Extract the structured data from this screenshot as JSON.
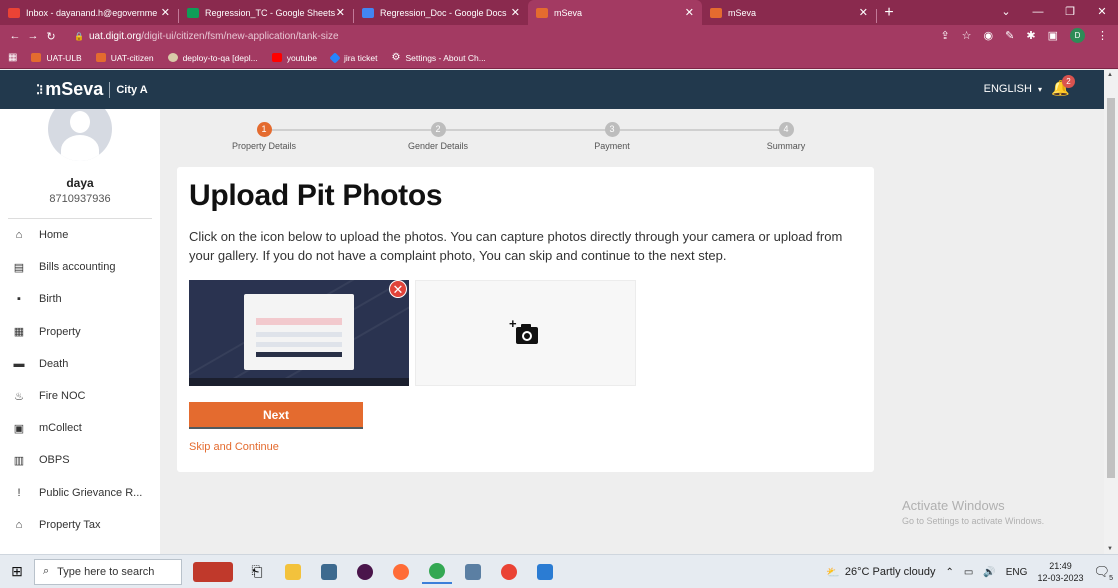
{
  "browser": {
    "tabs": [
      {
        "title": "Inbox - dayanand.h@egovernme",
        "icon_color": "#ea4335",
        "active": false
      },
      {
        "title": "Regression_TC - Google Sheets",
        "icon_color": "#0f9d58",
        "active": false
      },
      {
        "title": "Regression_Doc - Google Docs",
        "icon_color": "#4285f4",
        "active": false
      },
      {
        "title": "mSeva",
        "icon_color": "#e46b2f",
        "active": true
      },
      {
        "title": "mSeva",
        "icon_color": "#e46b2f",
        "active": false
      }
    ],
    "url_host": "uat.digit.org",
    "url_path": "/digit-ui/citizen/fsm/new-application/tank-size",
    "profile_initial": "D",
    "bookmarks": [
      {
        "label": "UAT-ULB",
        "icon_color": "#e46b2f"
      },
      {
        "label": "UAT-citizen",
        "icon_color": "#e46b2f"
      },
      {
        "label": "deploy-to-qa [depl...",
        "icon_color": "#d9c9a8"
      },
      {
        "label": "youtube",
        "icon_color": "#ff0000"
      },
      {
        "label": "jira ticket",
        "icon_color": "#2684ff"
      },
      {
        "label": "Settings - About Ch...",
        "icon_color": "#ffffff"
      }
    ]
  },
  "header": {
    "brand": "mSeva",
    "city": "City A",
    "language": "ENGLISH",
    "notification_count": "2"
  },
  "sidebar": {
    "user_name": "daya",
    "user_phone": "8710937936",
    "items": [
      {
        "label": "Home",
        "icon": "home-icon",
        "glyph": "⌂"
      },
      {
        "label": "Bills accounting",
        "icon": "bill-icon",
        "glyph": "▤"
      },
      {
        "label": "Birth",
        "icon": "birth-icon",
        "glyph": "▪"
      },
      {
        "label": "Property",
        "icon": "property-icon",
        "glyph": "▦"
      },
      {
        "label": "Death",
        "icon": "death-icon",
        "glyph": "▬"
      },
      {
        "label": "Fire NOC",
        "icon": "fire-icon",
        "glyph": "♨"
      },
      {
        "label": "mCollect",
        "icon": "collect-icon",
        "glyph": "▣"
      },
      {
        "label": "OBPS",
        "icon": "obps-icon",
        "glyph": "▥"
      },
      {
        "label": "Public Grievance R...",
        "icon": "grievance-icon",
        "glyph": "!"
      },
      {
        "label": "Property Tax",
        "icon": "property-tax-icon",
        "glyph": "⌂"
      }
    ]
  },
  "stepper": {
    "steps": [
      {
        "number": "1",
        "label": "Property Details",
        "active": true
      },
      {
        "number": "2",
        "label": "Gender Details",
        "active": false
      },
      {
        "number": "3",
        "label": "Payment",
        "active": false
      },
      {
        "number": "4",
        "label": "Summary",
        "active": false
      }
    ]
  },
  "main": {
    "title": "Upload Pit Photos",
    "description": "Click on the icon below to upload the photos. You can capture photos directly through your camera or upload from your gallery. If you do not have a complaint photo, You can skip and continue to the next step.",
    "next_label": "Next",
    "skip_label": "Skip and Continue"
  },
  "watermark": {
    "line1": "Activate Windows",
    "line2": "Go to Settings to activate Windows."
  },
  "taskbar": {
    "search_placeholder": "Type here to search",
    "weather": "26°C  Partly cloudy",
    "language": "ENG",
    "time": "21:49",
    "date": "12-03-2023",
    "notification_count": "5"
  },
  "colors": {
    "accent": "#e46b2f",
    "header_bg": "#22394d",
    "browser_bg": "#a33a62"
  }
}
